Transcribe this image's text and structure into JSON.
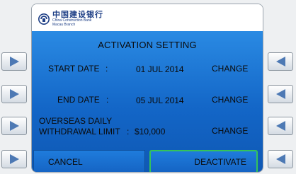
{
  "bank": {
    "name_cn": "中国建设银行",
    "name_en": "China Construction Bank",
    "branch": "Macau Branch",
    "brand_color": "#1e3f86"
  },
  "screen": {
    "title": "ACTIVATION SETTING",
    "rows": [
      {
        "label": "START DATE",
        "separator": ":",
        "value": "01 JUL 2014",
        "action": "CHANGE"
      },
      {
        "label": "END DATE",
        "separator": ":",
        "value": "05 JUL 2014",
        "action": "CHANGE"
      },
      {
        "label_line1": "OVERSEAS DAILY",
        "label_line2": "WITHDRAWAL LIMIT",
        "separator": ":",
        "value": "$10,000",
        "action": "CHANGE"
      }
    ],
    "cancel_label": "CANCEL",
    "deactivate_label": "DEACTIVATE",
    "highlight_color": "#34c35b",
    "panel_color": "#1a73d6"
  },
  "side_buttons": {
    "left_icon": "triangle-right-icon",
    "right_icon": "triangle-left-icon"
  }
}
